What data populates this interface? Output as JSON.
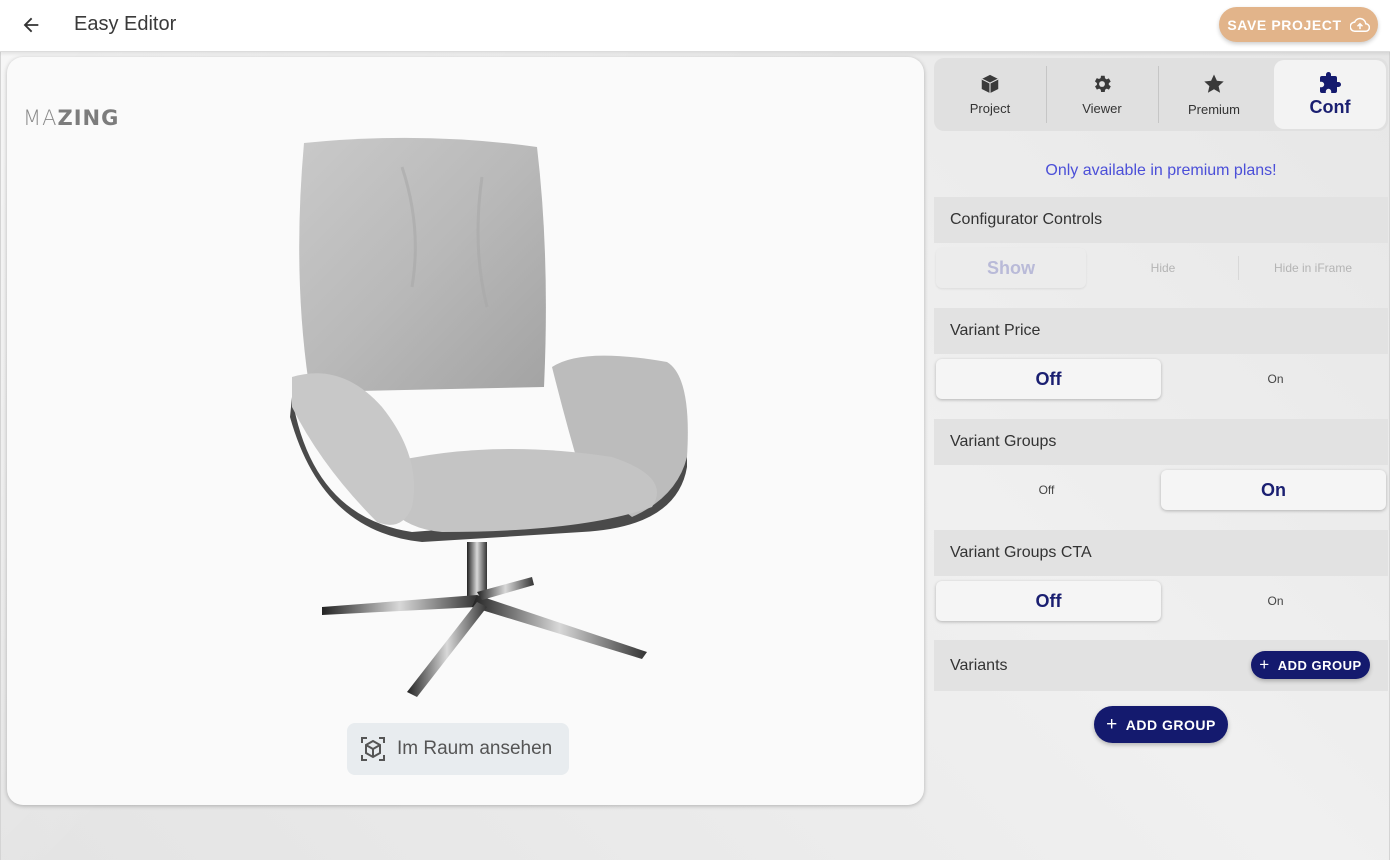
{
  "header": {
    "title": "Easy Editor",
    "save_label": "SAVE PROJECT",
    "save_color": "#e2b48a"
  },
  "viewer": {
    "logo_left": "MA",
    "logo_right": "ZING",
    "ar_button_label": "Im Raum ansehen"
  },
  "tabs": [
    {
      "label": "Project",
      "icon": "cube-icon"
    },
    {
      "label": "Viewer",
      "icon": "gear-icon"
    },
    {
      "label": "Premium",
      "icon": "star-icon"
    },
    {
      "label": "Conf",
      "icon": "puzzle-icon",
      "active": true
    }
  ],
  "panel": {
    "premium_note": "Only available in premium plans!",
    "configurator_controls": {
      "title": "Configurator Controls",
      "options": [
        "Show",
        "Hide",
        "Hide in iFrame"
      ],
      "selected": "Show",
      "disabled": true
    },
    "variant_price": {
      "title": "Variant Price",
      "options": [
        "Off",
        "On"
      ],
      "selected": "Off"
    },
    "variant_groups": {
      "title": "Variant Groups",
      "options": [
        "Off",
        "On"
      ],
      "selected": "On"
    },
    "variant_groups_cta": {
      "title": "Variant Groups CTA",
      "options": [
        "Off",
        "On"
      ],
      "selected": "Off"
    },
    "variants": {
      "title": "Variants",
      "add_group_label": "ADD GROUP"
    },
    "add_group_label": "ADD GROUP"
  },
  "colors": {
    "accent": "#141a6e",
    "premium_text": "#4b4fd8"
  }
}
